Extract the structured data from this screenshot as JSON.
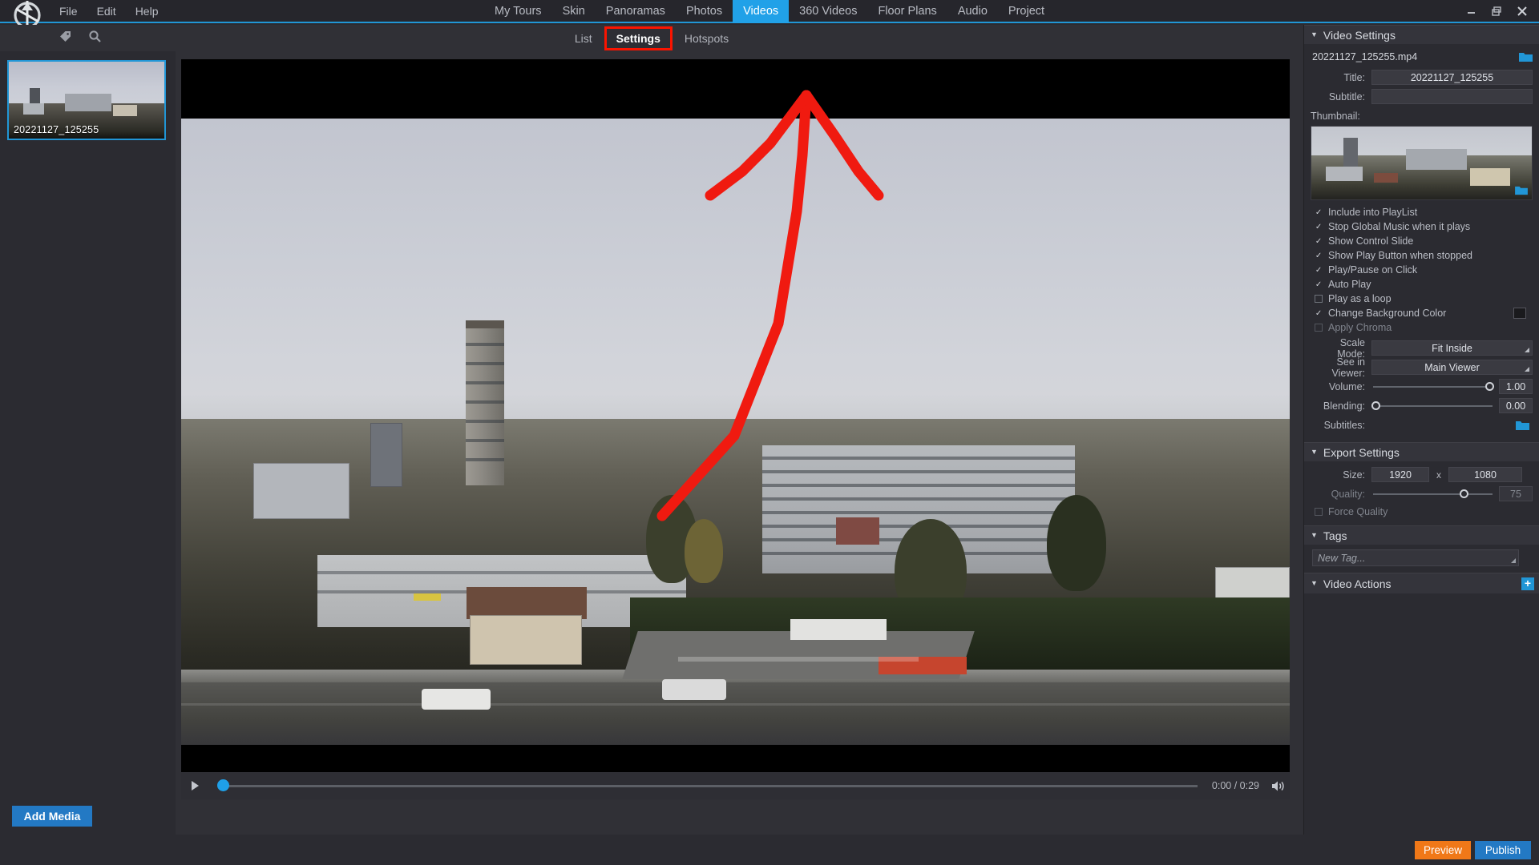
{
  "app": {
    "menus": [
      "File",
      "Edit",
      "Help"
    ],
    "logo_icon": "pano2vr-logo-icon",
    "window_controls": [
      "minimize-icon",
      "restore-icon",
      "close-icon"
    ]
  },
  "main_tabs": [
    {
      "label": "My Tours",
      "active": false
    },
    {
      "label": "Skin",
      "active": false
    },
    {
      "label": "Panoramas",
      "active": false
    },
    {
      "label": "Photos",
      "active": false
    },
    {
      "label": "Videos",
      "active": true
    },
    {
      "label": "360 Videos",
      "active": false
    },
    {
      "label": "Floor Plans",
      "active": false
    },
    {
      "label": "Audio",
      "active": false
    },
    {
      "label": "Project",
      "active": false
    }
  ],
  "sub_tabs": [
    {
      "label": "List",
      "selected": false
    },
    {
      "label": "Settings",
      "selected": true
    },
    {
      "label": "Hotspots",
      "selected": false
    }
  ],
  "toolbar_icons": [
    "tag-icon",
    "search-icon"
  ],
  "sidebar": {
    "items": [
      {
        "label": "20221127_125255",
        "selected": true
      }
    ],
    "add_media_label": "Add Media"
  },
  "player": {
    "play_icon": "play-icon",
    "time": "0:00 / 0:29",
    "volume_icon": "volume-icon",
    "progress_percent": 0,
    "annotation": "red-arrow-annotation"
  },
  "video_settings": {
    "section_title": "Video Settings",
    "filename": "20221127_125255.mp4",
    "open_file_icon": "folder-icon",
    "title_label": "Title:",
    "title_value": "20221127_125255",
    "subtitle_label": "Subtitle:",
    "subtitle_value": "",
    "thumbnail_label": "Thumbnail:",
    "thumbnail_pick_icon": "folder-icon",
    "checkboxes": [
      {
        "label": "Include into PlayList",
        "checked": true,
        "dim": false
      },
      {
        "label": "Stop Global Music when it plays",
        "checked": true,
        "dim": false
      },
      {
        "label": "Show Control Slide",
        "checked": true,
        "dim": false
      },
      {
        "label": "Show Play Button when stopped",
        "checked": true,
        "dim": false
      },
      {
        "label": "Play/Pause on Click",
        "checked": true,
        "dim": false
      },
      {
        "label": "Auto Play",
        "checked": true,
        "dim": false
      },
      {
        "label": "Play as a loop",
        "checked": false,
        "dim": false
      },
      {
        "label": "Change Background Color",
        "checked": true,
        "dim": false
      },
      {
        "label": "Apply Chroma",
        "checked": false,
        "dim": true
      }
    ],
    "background_color": "#1a1a1d",
    "scale_mode_label": "Scale Mode:",
    "scale_mode_value": "Fit Inside",
    "see_in_viewer_label": "See in Viewer:",
    "see_in_viewer_value": "Main Viewer",
    "volume_label": "Volume:",
    "volume_value": "1.00",
    "volume_percent": 100,
    "blending_label": "Blending:",
    "blending_value": "0.00",
    "blending_percent": 0,
    "subtitles_label": "Subtitles:",
    "subtitles_icon": "folder-icon"
  },
  "export_settings": {
    "section_title": "Export Settings",
    "size_label": "Size:",
    "width": "1920",
    "separator": "x",
    "height": "1080",
    "quality_label": "Quality:",
    "quality_value": "75",
    "quality_percent": 75,
    "force_quality_label": "Force Quality",
    "force_quality_checked": false
  },
  "tags": {
    "section_title": "Tags",
    "new_tag_placeholder": "New Tag..."
  },
  "video_actions": {
    "section_title": "Video Actions",
    "add_icon": "plus-icon"
  },
  "footer": {
    "preview_label": "Preview",
    "publish_label": "Publish"
  },
  "colors": {
    "accent": "#2196d6",
    "tab_active": "#21a1e8",
    "highlight_box": "#fa1400",
    "preview_button": "#f07818",
    "publish_button": "#2379c4"
  }
}
